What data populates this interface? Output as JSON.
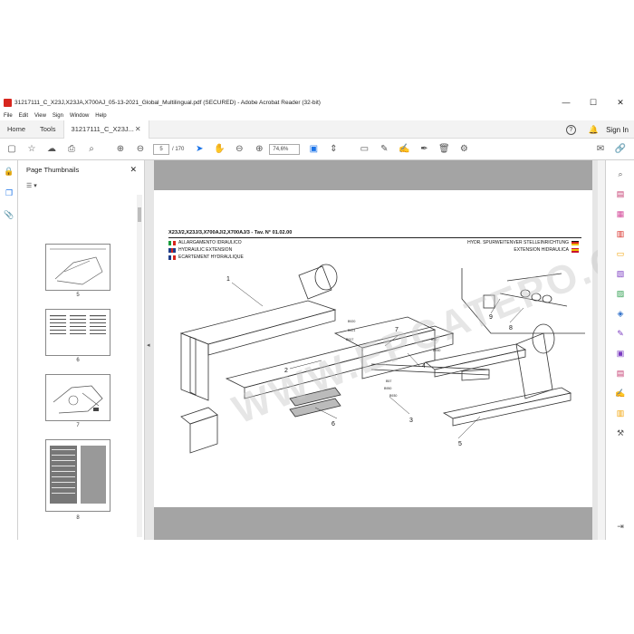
{
  "window": {
    "title": "31217111_C_X23J,X23JA,X700AJ_05-13-2021_Global_Multilingual.pdf (SECURED) - Adobe Acrobat Reader (32-bit)",
    "controls": [
      "—",
      "☐",
      "✕"
    ]
  },
  "menu": [
    "File",
    "Edit",
    "View",
    "Sign",
    "Window",
    "Help"
  ],
  "tabs": {
    "home": "Home",
    "tools": "Tools",
    "document": "31217111_C_X23J...",
    "sign_in": "Sign In"
  },
  "toolbar": {
    "current_page": "5",
    "total_pages": "/ 170",
    "zoom": "74,6%"
  },
  "thumbnails_pane": {
    "title": "Page Thumbnails",
    "pages": [
      "5",
      "6",
      "7",
      "8"
    ]
  },
  "document_page": {
    "header_left": "X23J/2,X23J/3,X700AJ/2,X700AJ/3 - Tav. N° 01.02.00",
    "lang_it": "ALLARGAMENTO IDRAULICO",
    "lang_en": "HYDRAULIC EXTENSION",
    "lang_fr": "ECARTEMENT HYDRAULIQUE",
    "lang_de": "HYDR. SPURWEITENVER STELLEINRICHTUNG",
    "lang_es": "EXTENSION HIDRAULICA",
    "watermark": "WWW.EPCATEPO.COM",
    "callouts": [
      "1",
      "2",
      "3",
      "4",
      "5",
      "6",
      "7",
      "8",
      "9"
    ],
    "small_labels": [
      "B920",
      "B917",
      "B921",
      "B930",
      "B90",
      "B950",
      "B57",
      "B930"
    ]
  },
  "colors": {
    "accent": "#1a73e8",
    "acrobat_red": "#d7261e",
    "gray_page_bar": "#a4a4a4"
  }
}
